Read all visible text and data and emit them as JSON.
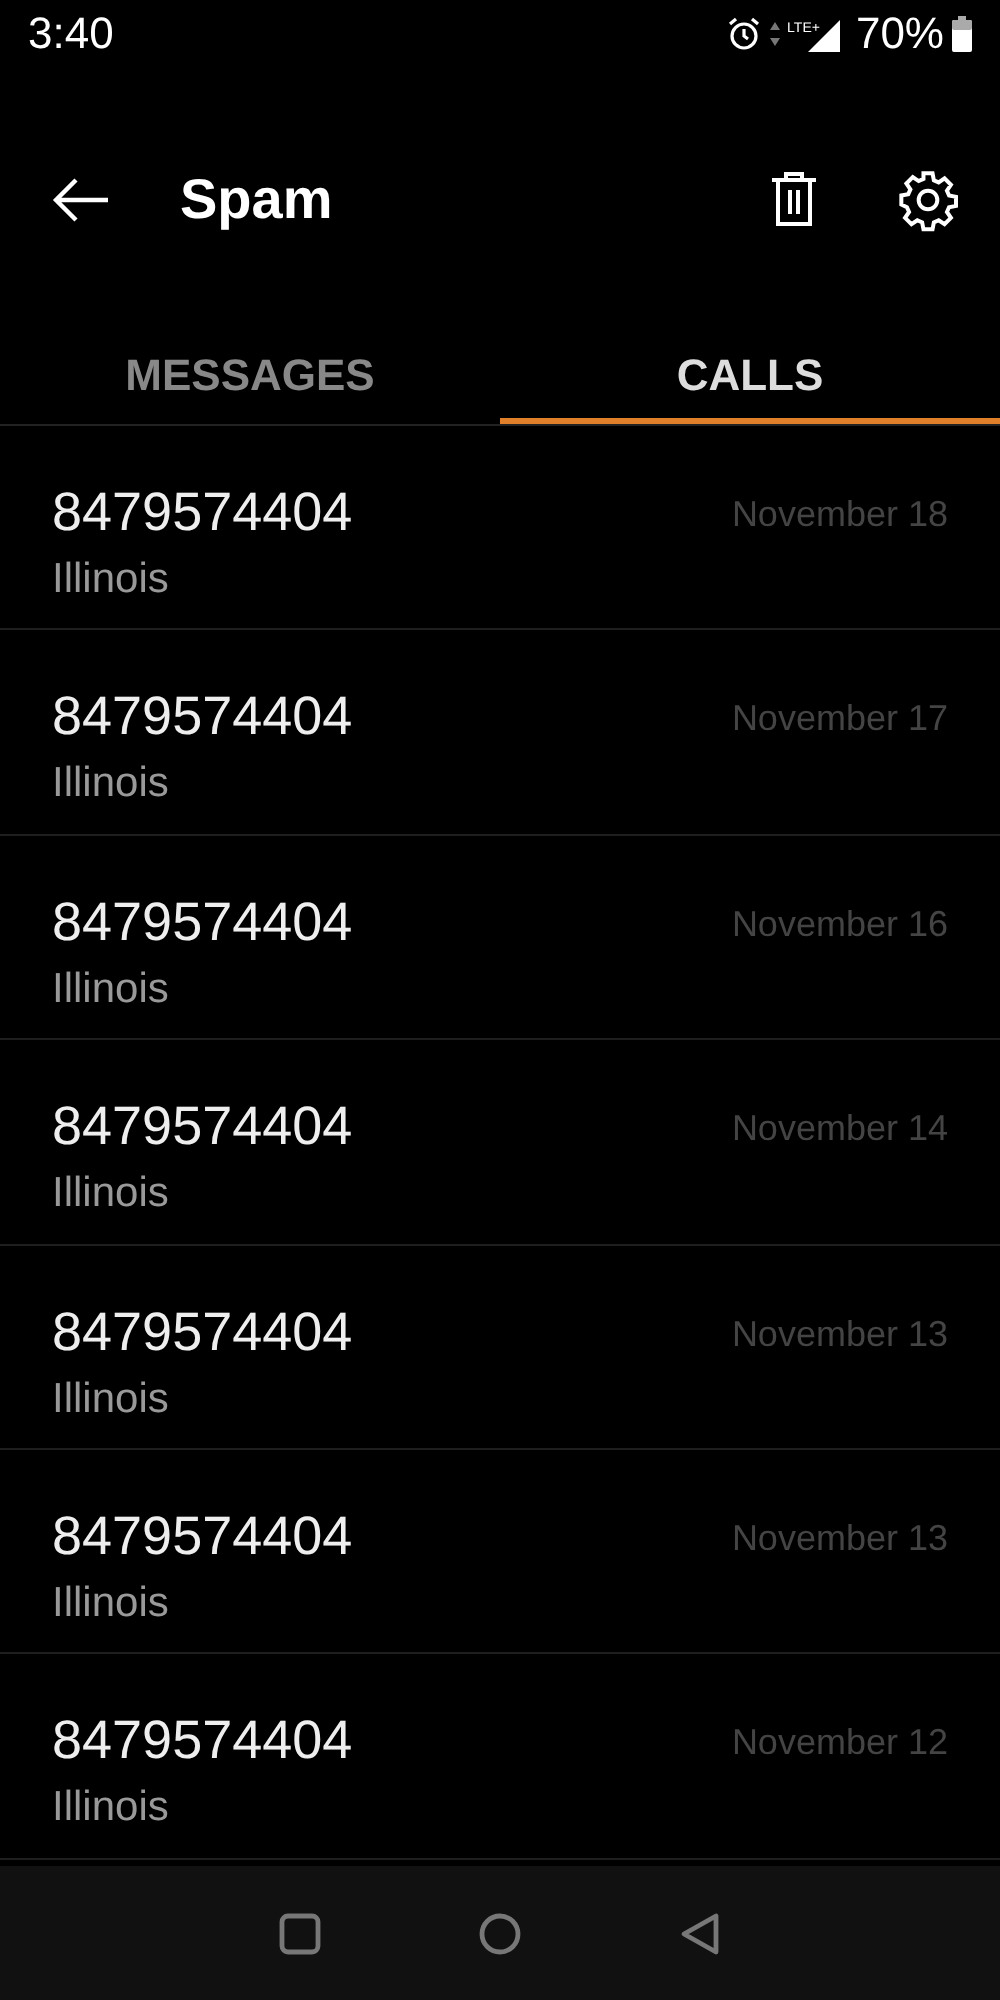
{
  "status_bar": {
    "time": "3:40",
    "network": "LTE+",
    "battery": "70%"
  },
  "header": {
    "title": "Spam"
  },
  "tabs": [
    {
      "label": "MESSAGES",
      "selected": false
    },
    {
      "label": "CALLS",
      "selected": true
    }
  ],
  "calls": [
    {
      "number": "8479574404",
      "location": "Illinois",
      "date": "November 18"
    },
    {
      "number": "8479574404",
      "location": "Illinois",
      "date": "November 17"
    },
    {
      "number": "8479574404",
      "location": "Illinois",
      "date": "November 16"
    },
    {
      "number": "8479574404",
      "location": "Illinois",
      "date": "November 14"
    },
    {
      "number": "8479574404",
      "location": "Illinois",
      "date": "November 13"
    },
    {
      "number": "8479574404",
      "location": "Illinois",
      "date": "November 13"
    },
    {
      "number": "8479574404",
      "location": "Illinois",
      "date": "November 12"
    }
  ]
}
